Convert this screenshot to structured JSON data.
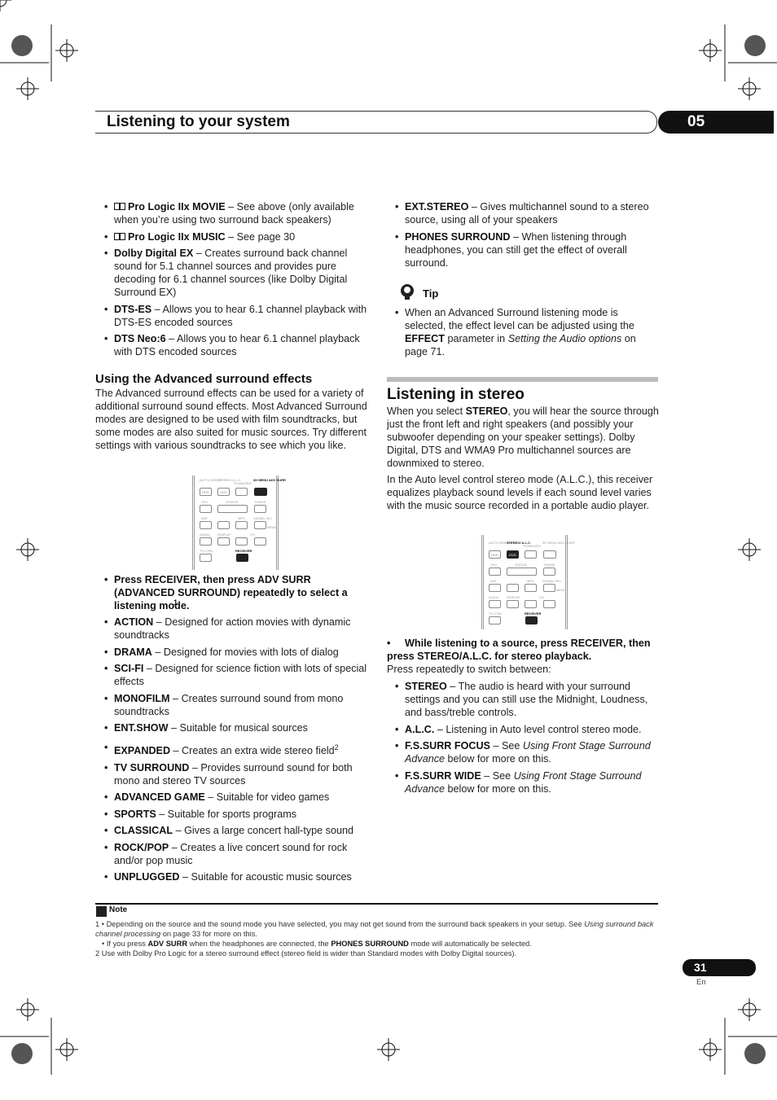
{
  "header": {
    "title": "Listening to your system",
    "chapter": "05"
  },
  "left": {
    "list1": [
      {
        "term": "Pro Logic IIx MOVIE",
        "text": " – See above (only available when you’re using two surround back speakers)",
        "dolby": true
      },
      {
        "term": "Pro Logic IIx MUSIC",
        "text": " – See page 30",
        "dolby": true
      },
      {
        "term": "Dolby Digital EX",
        "text": " – Creates surround back channel sound for 5.1 channel sources and provides pure decoding for 6.1 channel sources (like Dolby Digital Surround EX)"
      },
      {
        "term": "DTS-ES",
        "text": " – Allows you to hear 6.1 channel playback with DTS-ES encoded sources"
      },
      {
        "term": "DTS Neo:6",
        "text": " – Allows you to hear 6.1 channel playback with DTS encoded sources"
      }
    ],
    "heading": "Using the Advanced surround effects",
    "para": "The Advanced surround effects can be used for a variety of additional surround sound effects. Most Advanced Surround modes are designed to be used with film soundtracks, but some modes are also suited for music sources. Try different settings with various soundtracks to see which you like.",
    "instruction": "Press RECEIVER, then press ADV SURR (ADVANCED SURROUND) repeatedly to select a listening mode.",
    "instruction_sup": "1",
    "list2": [
      {
        "term": "ACTION",
        "text": " – Designed for action movies with dynamic soundtracks"
      },
      {
        "term": "DRAMA",
        "text": " – Designed for movies with lots of dialog"
      },
      {
        "term": "SCI-FI",
        "text": " – Designed for science fiction with lots of special effects"
      },
      {
        "term": "MONOFILM",
        "text": " – Creates surround sound from mono soundtracks"
      },
      {
        "term": "ENT.SHOW",
        "text": " – Suitable for musical sources"
      },
      {
        "term": "EXPANDED",
        "text": " – Creates an extra wide stereo field",
        "sup": "2"
      },
      {
        "term": "TV SURROUND",
        "text": " – Provides surround sound for both mono and stereo TV sources"
      },
      {
        "term": "ADVANCED GAME",
        "text": " – Suitable for video games"
      },
      {
        "term": "SPORTS",
        "text": " – Suitable for sports programs"
      },
      {
        "term": "CLASSICAL",
        "text": " – Gives a large concert hall-type sound"
      },
      {
        "term": "ROCK/POP",
        "text": " – Creates a live concert sound for rock and/or pop music"
      },
      {
        "term": "UNPLUGGED",
        "text": " – Suitable for acoustic music sources"
      }
    ]
  },
  "remote": {
    "auto_direct": "AUTO/ DIRECT",
    "hdd": "HDD",
    "stereo_alc": "STEREO/ A.L.C.",
    "dvd": "DVD",
    "standard": "STANDARD",
    "menu_adv": "3D MENU ADV SURR",
    "thx": "THX",
    "status": "STATUS",
    "phase": "PHASE",
    "ant": "ANT",
    "mpx": "MPX",
    "signal_sel": "SIGNAL SEL",
    "menu": "MENU",
    "audio": "AUDIO",
    "display": "DISPLAY",
    "ch": "CH",
    "tv_ctrl": "TV CTRL",
    "receiver": "RECEIVER"
  },
  "right": {
    "list1": [
      {
        "term": "EXT.STEREO",
        "text": " – Gives multichannel sound to a stereo source, using all of your speakers"
      },
      {
        "term": "PHONES SURROUND",
        "text": " – When listening through headphones, you can still get the effect of overall surround."
      }
    ],
    "tip_title": "Tip",
    "tip": {
      "a": "When an Advanced Surround listening mode is selected, the effect level can be adjusted using the ",
      "b": "EFFECT",
      "c": " parameter in ",
      "i": "Setting the Audio options",
      "d": " on page 71."
    },
    "heading": "Listening in stereo",
    "para1": {
      "a": "When you select ",
      "b": "STEREO",
      "c": ", you will hear the source through just the front left and right speakers (and possibly your subwoofer depending on your speaker settings). Dolby Digital, DTS and WMA9 Pro multichannel sources are downmixed to stereo."
    },
    "para2": "In the Auto level control stereo mode (A.L.C.), this receiver equalizes playback sound levels if each sound level varies with the music source recorded in a portable audio player.",
    "instruction": "While listening to a source, press RECEIVER, then press STEREO/A.L.C. for stereo playback.",
    "sub": "Press repeatedly to switch between:",
    "list2": [
      {
        "term": "STEREO",
        "text": " – The audio is heard with your surround settings and you can still use the Midnight, Loudness, and bass/treble controls."
      },
      {
        "term": "A.L.C.",
        "text": " – Listening in Auto level control stereo mode."
      },
      {
        "term": "F.S.SURR FOCUS",
        "text": " – See ",
        "ital": "Using Front Stage Surround Advance",
        "tail": " below for more on this."
      },
      {
        "term": "F.S.SURR WIDE",
        "text": " – See ",
        "ital": "Using Front Stage Surround Advance",
        "tail": " below for more on this."
      }
    ]
  },
  "note": {
    "title": "Note",
    "fn1a": "1  • Depending on the source and the sound mode you have selected, you may not get sound from the surround back speakers in your setup. See ",
    "fn1i": "Using surround back channel processing",
    "fn1b": " on page 33 for more on this.",
    "fn1c": "• If you press ",
    "fn1d": "ADV SURR",
    "fn1e": " when the headphones are connected, the ",
    "fn1f": "PHONES SURROUND",
    "fn1g": " mode will automatically be selected.",
    "fn2": "2  Use with Dolby Pro Logic for a stereo surround effect (stereo field is wider than Standard modes with Dolby Digital sources)."
  },
  "footer": {
    "page": "31",
    "lang": "En"
  }
}
